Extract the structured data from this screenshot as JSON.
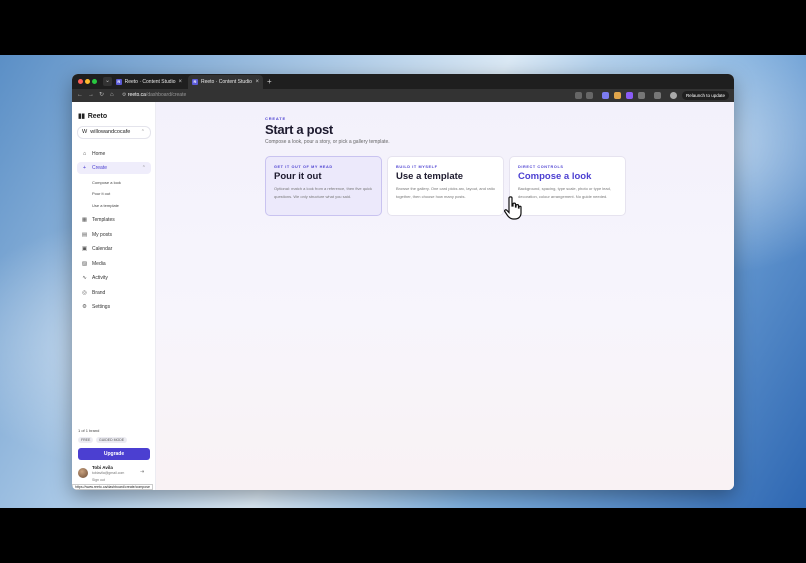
{
  "browser": {
    "tabs": [
      {
        "title": "Reeto · Content Studio",
        "active": false
      },
      {
        "title": "Reeto · Content Studio",
        "active": true
      }
    ],
    "url_host": "reeto.ca",
    "url_path": "/dashboard/create",
    "relaunch_label": "Relaunch to update",
    "status_url": "https://www.reeto.ca/dashboard/create/compose"
  },
  "sidebar": {
    "brand": "Reeto",
    "workspace_initial": "W",
    "workspace": "willowandcocafe",
    "items": [
      {
        "label": "Home",
        "icon": "home-icon"
      },
      {
        "label": "Create",
        "icon": "plus-icon"
      },
      {
        "label": "Templates",
        "icon": "grid-icon"
      },
      {
        "label": "My posts",
        "icon": "file-icon"
      },
      {
        "label": "Calendar",
        "icon": "calendar-icon"
      },
      {
        "label": "Media",
        "icon": "image-icon"
      },
      {
        "label": "Activity",
        "icon": "activity-icon"
      },
      {
        "label": "Brand",
        "icon": "palette-icon"
      },
      {
        "label": "Settings",
        "icon": "gear-icon"
      }
    ],
    "create_sub": [
      "Compose a look",
      "Pour it out",
      "Use a template"
    ],
    "plan": "1 of 1 brand",
    "pills": [
      "FREE",
      "GUIDED MODE"
    ],
    "upgrade": "Upgrade",
    "user_name": "Tobi Avila",
    "user_email": "tobiavila@gmail.com",
    "sign_out": "Sign out"
  },
  "main": {
    "eyebrow": "CREATE",
    "title": "Start a post",
    "subtitle": "Compose a look, pour a story, or pick a gallery template.",
    "cards": [
      {
        "kicker": "GET IT OUT OF MY HEAD",
        "title": "Pour it out",
        "desc": "Optional: match a look from a reference, then five quick questions. We only structure what you said."
      },
      {
        "kicker": "BUILD IT MYSELF",
        "title": "Use a template",
        "desc": "Browse the gallery. One card picks arc, layout, and ratio together, then choose how many posts."
      },
      {
        "kicker": "DIRECT CONTROLS",
        "title": "Compose a look",
        "desc": "Background, spacing, type scale, photo or type lead, decoration, colour arrangement. No guide needed."
      }
    ]
  },
  "colors": {
    "accent": "#4b3fd1",
    "selected_card": "#ece9fb"
  }
}
